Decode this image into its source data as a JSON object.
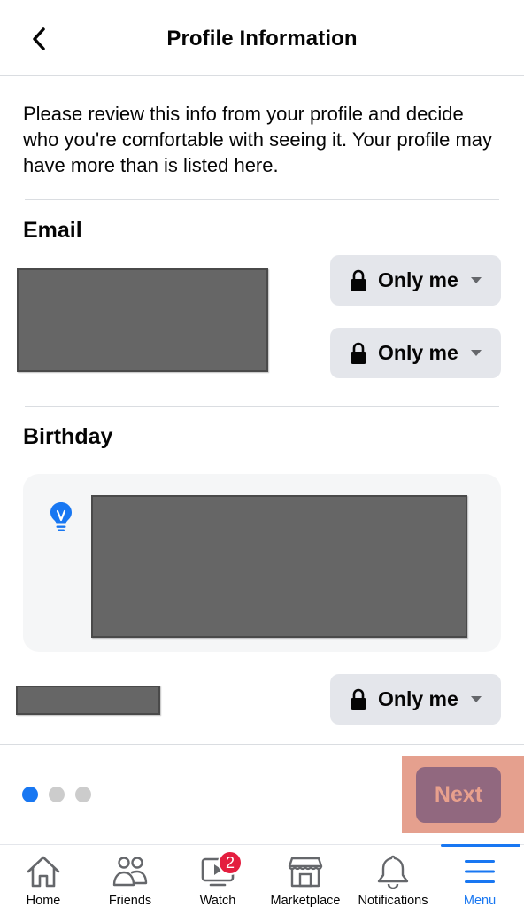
{
  "header": {
    "title": "Profile Information",
    "back_icon": "chevron-left-icon"
  },
  "intro_text": "Please review this info from your profile and decide who you're comfortable with seeing it. Your profile may have more than is listed here.",
  "sections": {
    "email": {
      "title": "Email",
      "privacy": [
        {
          "label": "Only me",
          "icon": "lock-icon"
        },
        {
          "label": "Only me",
          "icon": "lock-icon"
        }
      ]
    },
    "birthday": {
      "title": "Birthday",
      "tip_icon": "lightbulb-icon",
      "privacy": [
        {
          "label": "Only me",
          "icon": "lock-icon"
        }
      ]
    }
  },
  "pagination": {
    "total": 3,
    "current": 1
  },
  "next_button": {
    "label": "Next"
  },
  "tabbar": {
    "items": [
      {
        "label": "Home",
        "icon": "home-icon"
      },
      {
        "label": "Friends",
        "icon": "friends-icon"
      },
      {
        "label": "Watch",
        "icon": "watch-icon",
        "badge": "2"
      },
      {
        "label": "Marketplace",
        "icon": "marketplace-icon"
      },
      {
        "label": "Notifications",
        "icon": "bell-icon"
      },
      {
        "label": "Menu",
        "icon": "menu-icon",
        "active": true
      }
    ]
  },
  "colors": {
    "accent": "#1877f2",
    "badge": "#e41e3f",
    "button_bg": "#e4e6eb",
    "next_highlight": "#e5a08e",
    "next_button": "#91687f"
  }
}
